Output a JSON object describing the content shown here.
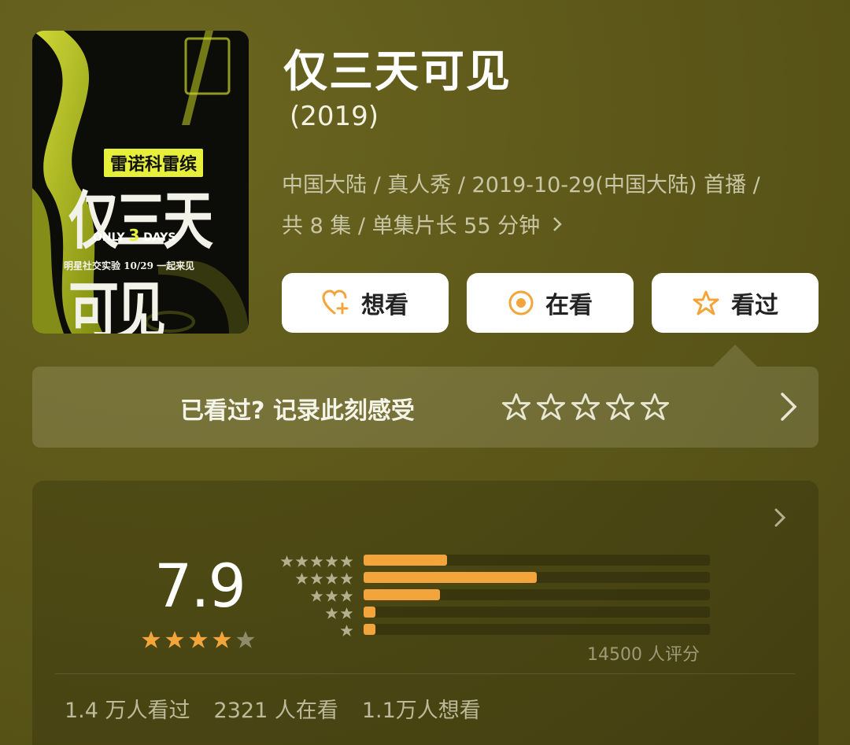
{
  "poster": {
    "top_label": "雷诺科雷缤",
    "title": "仅三天可见",
    "subtitle_prefix": "ONLY ",
    "subtitle_num": "3",
    "subtitle_suffix": " DAYS",
    "bottom_line": "明星社交实验  10/29  一起来见"
  },
  "title": "仅三天可见",
  "year": "(2019)",
  "meta_line1": "中国大陆 / 真人秀 / 2019-10-29(中国大陆) 首播 /",
  "meta_line2": "共 8 集 / 单集片长 55 分钟",
  "actions": {
    "want": "想看",
    "watching": "在看",
    "watched": "看过"
  },
  "rate_prompt": "已看过? 记录此刻感受",
  "rating": {
    "score": "7.9",
    "stars_filled": 4,
    "raters": "14500 人评分",
    "distribution": [
      0.24,
      0.5,
      0.22,
      0.035,
      0.035
    ]
  },
  "stats": [
    "1.4 万人看过",
    "2321 人在看",
    "1.1万人想看"
  ],
  "colors": {
    "background": "#5b5618",
    "accent": "#f3a53b",
    "poster_yellow": "#e6f03a"
  },
  "icons": {
    "want": "heart-plus-icon",
    "watching": "target-circle-icon",
    "watched": "star-outline-icon"
  }
}
